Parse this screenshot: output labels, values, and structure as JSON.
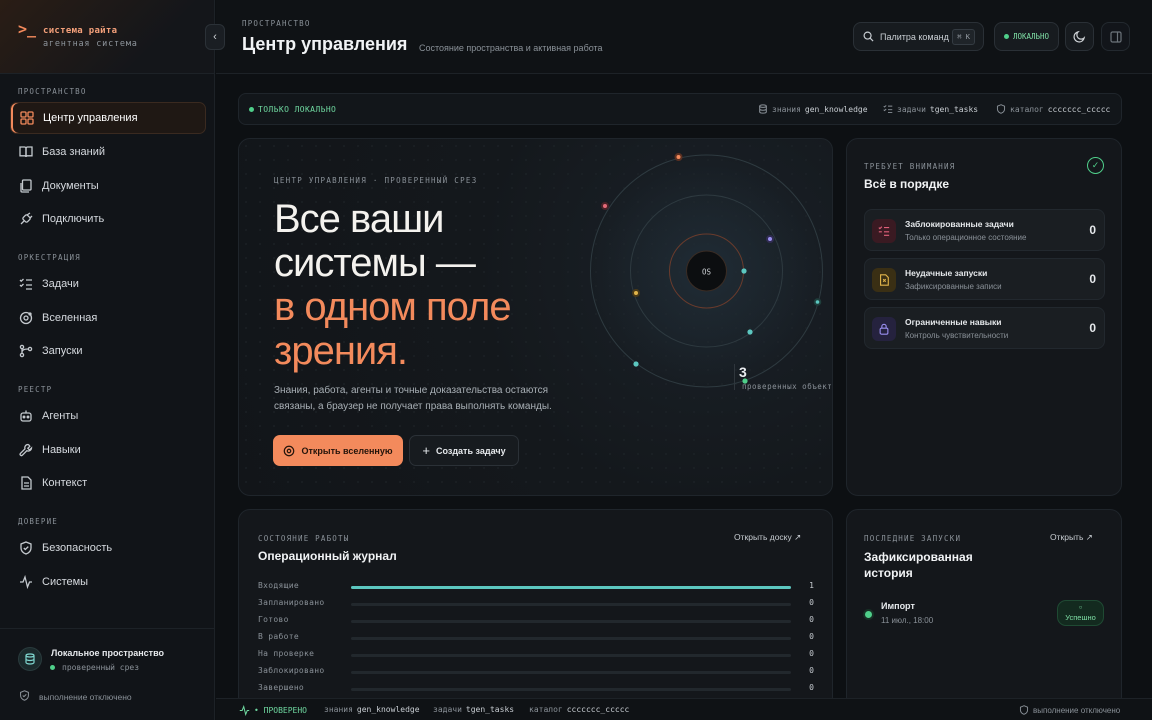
{
  "brand": {
    "prompt": ">_",
    "name": "система райта",
    "tagline": "агентная система"
  },
  "sidebar": {
    "sections": [
      {
        "label": "ПРОСТРАНСТВО",
        "items": [
          {
            "label": "Центр управления",
            "icon": "dashboard-icon",
            "active": true
          },
          {
            "label": "База знаний",
            "icon": "book-icon"
          },
          {
            "label": "Документы",
            "icon": "documents-icon"
          },
          {
            "label": "Подключить",
            "icon": "plug-icon"
          }
        ]
      },
      {
        "label": "ОРКЕСТРАЦИЯ",
        "items": [
          {
            "label": "Задачи",
            "icon": "tasks-icon"
          },
          {
            "label": "Вселенная",
            "icon": "orbit-icon"
          },
          {
            "label": "Запуски",
            "icon": "runs-icon"
          }
        ]
      },
      {
        "label": "РЕЕСТР",
        "items": [
          {
            "label": "Агенты",
            "icon": "agents-icon"
          },
          {
            "label": "Навыки",
            "icon": "wrench-icon"
          },
          {
            "label": "Контекст",
            "icon": "context-icon"
          }
        ]
      },
      {
        "label": "ДОВЕРИЕ",
        "items": [
          {
            "label": "Безопасность",
            "icon": "shield-icon"
          },
          {
            "label": "Системы",
            "icon": "pulse-icon"
          }
        ]
      }
    ],
    "workspace": {
      "title": "Локальное пространство",
      "subtitle": "проверенный срез"
    },
    "execution": "выполнение отключено"
  },
  "header": {
    "eyebrow": "ПРОСТРАНСТВО",
    "title": "Центр управления",
    "subtitle": "Состояние пространства и активная работа",
    "command_palette": "Палитра команд",
    "shortcut": "⌘ K",
    "local_badge": "ЛОКАЛЬНО"
  },
  "strip": {
    "local_only": "ТОЛЬКО ЛОКАЛЬНО",
    "knowledge_label": "знания",
    "knowledge_value": "gen_knowledge",
    "tasks_label": "задачи",
    "tasks_value": "tgen_tasks",
    "catalog_label": "каталог",
    "catalog_value": "ccccccc_ccccc"
  },
  "hero": {
    "eyebrow": "ЦЕНТР УПРАВЛЕНИЯ · ПРОВЕРЕННЫЙ СРЕЗ",
    "line1": "Все ваши",
    "line2": "системы —",
    "line3": "в одном поле",
    "line4": "зрения.",
    "paragraph": "Знания, работа, агенты и точные доказательства остаются связаны, а браузер не получает права выполнять команды.",
    "primary_button": "Открыть вселенную",
    "secondary_button": "Создать задачу",
    "core_label": "OS",
    "verified_count": "3",
    "verified_label": "проверенных объекта"
  },
  "attention": {
    "eyebrow": "ТРЕБУЕТ ВНИМАНИЯ",
    "title": "Всё в порядке",
    "items": [
      {
        "title": "Заблокированные задачи",
        "subtitle": "Только операционное состояние",
        "value": "0",
        "icon": "blocked-tasks-icon",
        "color": "#e0607a"
      },
      {
        "title": "Неудачные запуски",
        "subtitle": "Зафиксированные записи",
        "value": "0",
        "icon": "failed-runs-icon",
        "color": "#e0b44a"
      },
      {
        "title": "Ограниченные навыки",
        "subtitle": "Контроль чувствительности",
        "value": "0",
        "icon": "lock-icon",
        "color": "#9a8ff0"
      }
    ]
  },
  "journal": {
    "eyebrow": "СОСТОЯНИЕ РАБОТЫ",
    "title": "Операционный журнал",
    "open_link": "Открыть доску",
    "rows": [
      {
        "label": "Входящие",
        "value": "1",
        "fill": 1.0
      },
      {
        "label": "Запланировано",
        "value": "0",
        "fill": 0
      },
      {
        "label": "Готово",
        "value": "0",
        "fill": 0
      },
      {
        "label": "В работе",
        "value": "0",
        "fill": 0
      },
      {
        "label": "На проверке",
        "value": "0",
        "fill": 0
      },
      {
        "label": "Заблокировано",
        "value": "0",
        "fill": 0
      },
      {
        "label": "Завершено",
        "value": "0",
        "fill": 0
      }
    ]
  },
  "runs": {
    "eyebrow": "ПОСЛЕДНИЕ ЗАПУСКИ",
    "title": "Зафиксированная история",
    "open_link": "Открыть",
    "item": {
      "title": "Импорт",
      "date": "11 июл., 18:00",
      "status": "Успешно"
    }
  },
  "footer": {
    "verified": "• ПРОВЕРЕНО",
    "knowledge_label": "знания",
    "knowledge_value": "gen_knowledge",
    "tasks_label": "задачи",
    "tasks_value": "tgen_tasks",
    "catalog_label": "каталог",
    "catalog_value": "ccccccc_ccccc",
    "execution": "выполнение отключено"
  },
  "colors": {
    "accent": "#f38a5c",
    "success": "#4fcf8a",
    "teal": "#5cc7c0",
    "background": "#0d1013"
  }
}
